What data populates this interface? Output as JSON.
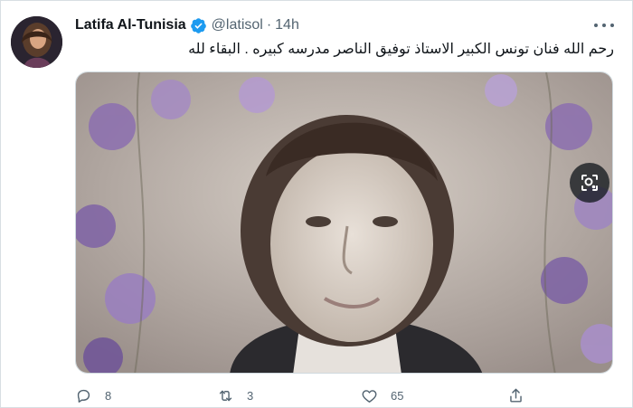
{
  "tweet": {
    "author": {
      "display_name": "Latifa Al-Tunisia",
      "verified": true,
      "handle": "@latisol",
      "separator": "·",
      "time": "14h"
    },
    "text": "رحم الله فنان تونس الكبير الاستاذ توفيق الناصر  مدرسه كبيره . البقاء لله",
    "media": {
      "icons": [
        "lens-icon",
        "share-icon"
      ]
    },
    "actions": {
      "reply_count": "8",
      "retweet_count": "3",
      "like_count": "65"
    }
  },
  "colors": {
    "text_primary": "#0f1419",
    "text_secondary": "#536471",
    "verified_blue": "#1d9bf0",
    "border": "#d8dee3"
  }
}
